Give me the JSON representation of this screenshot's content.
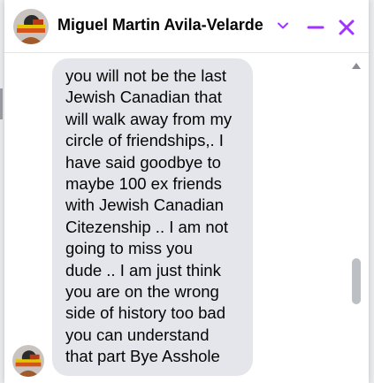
{
  "chat": {
    "contact_name": "Miguel Martin Avila-Velarde",
    "message_lines": [
      "you will not be the last",
      "Jewish Canadian that",
      "will walk away from my",
      "circle of friendships,. I",
      "have said goodbye to",
      "maybe 100 ex friends",
      "with Jewish Canadian",
      "Citezenship .. I am not",
      "going to miss you",
      "dude .. I am just think",
      "you are on the wrong",
      "side of history too bad",
      "you can understand",
      "that part Bye Asshole"
    ]
  },
  "icons": {
    "avatar": "profile-photo-avatar",
    "chevron": "chevron-down-icon",
    "minimize": "minimize-icon",
    "close": "close-icon",
    "scroll_up": "scroll-up-arrow-icon"
  },
  "colors": {
    "accent": "#a033ff",
    "bubble": "#e4e6eb",
    "text": "#050505",
    "scroll_thumb": "#bcc0c4"
  }
}
